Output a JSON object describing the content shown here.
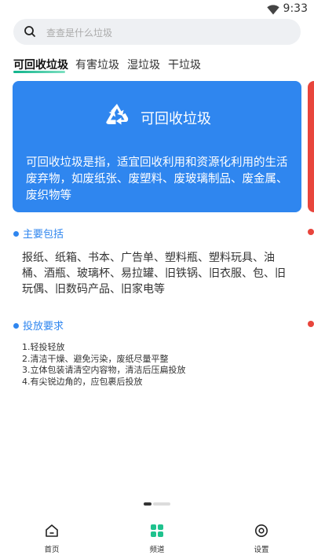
{
  "status_bar": {
    "time": "9:33",
    "wifi_icon": "wifi-icon"
  },
  "search": {
    "placeholder": "查查是什么垃圾",
    "icon": "search-icon"
  },
  "tabs": [
    {
      "label": "可回收垃圾",
      "active": true
    },
    {
      "label": "有害垃圾",
      "active": false
    },
    {
      "label": "湿垃圾",
      "active": false
    },
    {
      "label": "干垃圾",
      "active": false
    }
  ],
  "card": {
    "icon": "recycle-icon",
    "title": "可回收垃圾",
    "description": "可回收垃圾是指，适宜回收利用和资源化利用的生活废弃物，如废纸张、废塑料、废玻璃制品、废金属、废织物等",
    "color": "#2f86ef"
  },
  "main_items": {
    "heading": "主要包括",
    "text": "报纸、纸箱、书本、广告单、塑料瓶、塑料玩具、油桶、酒瓶、玻璃杯、易拉罐、旧铁锅、旧衣服、包、旧玩偶、旧数码产品、旧家电等"
  },
  "requirements": {
    "heading": "投放要求",
    "lines": [
      "1.轻投轻放",
      "2.清洁干燥、避免污染，废纸尽量平整",
      "3.立体包装请清空内容物，清洁后压扁投放",
      "4.有尖锐边角的，应包裹后投放"
    ]
  },
  "pager": {
    "current": 1,
    "total": 4
  },
  "bottom_nav": [
    {
      "label": "首页",
      "icon": "home-icon"
    },
    {
      "label": "频道",
      "icon": "grid-icon"
    },
    {
      "label": "设置",
      "icon": "settings-icon"
    }
  ],
  "colors": {
    "accent": "#2f86ef",
    "next_card": "#e8453c",
    "tab_indicator": "#0fb38b"
  }
}
